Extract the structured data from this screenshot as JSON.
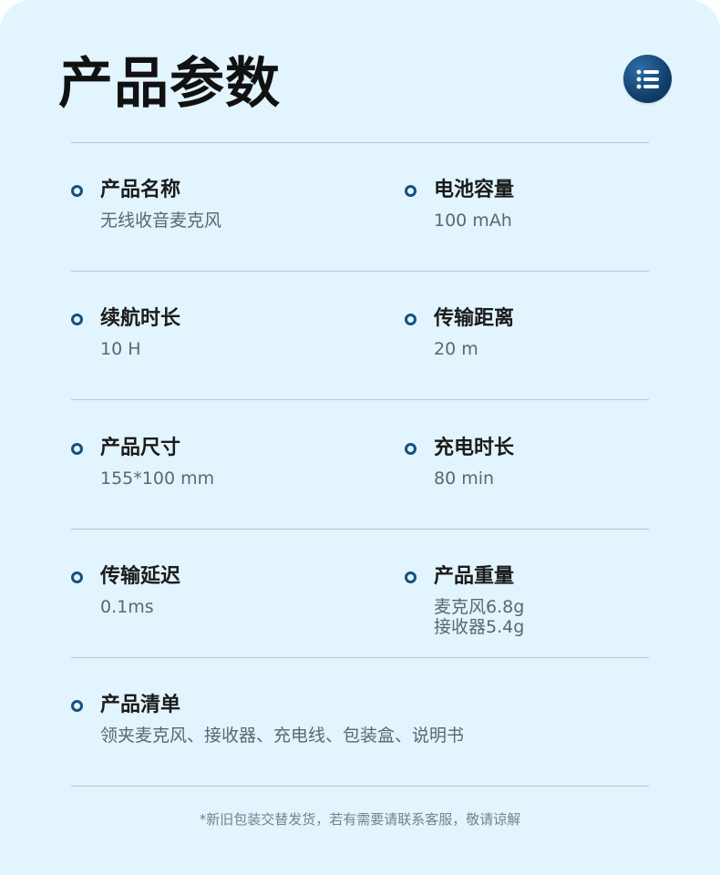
{
  "header": {
    "title": "产品参数",
    "menu_icon": "list-icon"
  },
  "specs": {
    "product_name": {
      "label": "产品名称",
      "value": "无线收音麦克风"
    },
    "battery": {
      "label": "电池容量",
      "value": "100 mAh"
    },
    "endurance": {
      "label": "续航时长",
      "value": "10 H"
    },
    "range": {
      "label": "传输距离",
      "value": "20 m"
    },
    "size": {
      "label": "产品尺寸",
      "value": "155*100 mm"
    },
    "charge_time": {
      "label": "充电时长",
      "value": "80 min"
    },
    "latency": {
      "label": "传输延迟",
      "value": "0.1ms"
    },
    "weight": {
      "label": "产品重量",
      "value_line1": "麦克风6.8g",
      "value_line2": "接收器5.4g"
    },
    "package": {
      "label": "产品清单",
      "value": "领夹麦克风、接收器、充电线、包装盒、说明书"
    }
  },
  "footer": {
    "note": "*新旧包装交替发货，若有需要请联系客服，敬请谅解"
  },
  "colors": {
    "background": "#e2f4fd",
    "accent": "#17507c",
    "title": "#111111",
    "value_text": "#5c6770"
  }
}
